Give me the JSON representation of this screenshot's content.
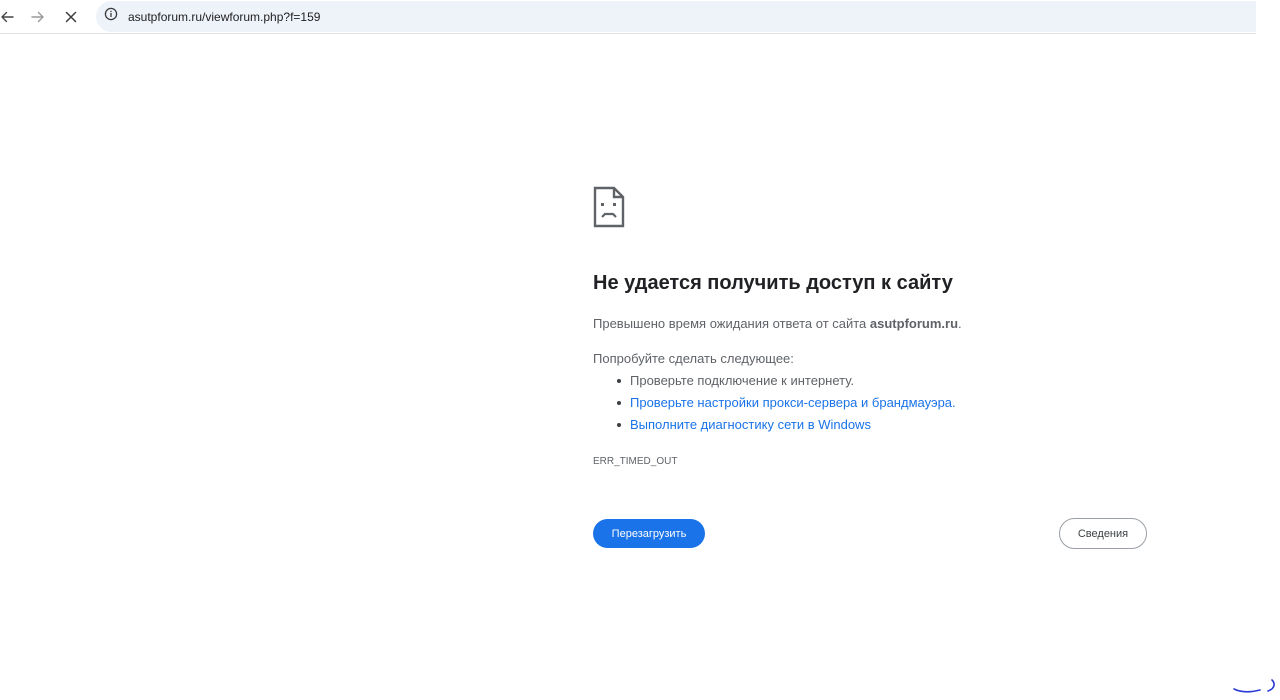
{
  "browser": {
    "url": "asutpforum.ru/viewforum.php?f=159",
    "icons": {
      "back": "arrow-left-icon",
      "forward": "arrow-right-icon",
      "stop": "close-icon",
      "site_info": "info-icon"
    }
  },
  "error_page": {
    "icon": "sad-page-icon",
    "heading": "Не удается получить доступ к сайту",
    "summary_prefix": "Превышено время ожидания ответа от сайта ",
    "summary_site": "asutpforum.ru",
    "summary_suffix": ".",
    "suggestions_title": "Попробуйте сделать следующее:",
    "suggestions": [
      {
        "text": "Проверьте подключение к интернету.",
        "link": false
      },
      {
        "text": "Проверьте настройки прокси-сервера и брандмауэра.",
        "link": true
      },
      {
        "text": "Выполните диагностику сети в Windows",
        "link": true
      }
    ],
    "error_code": "ERR_TIMED_OUT",
    "reload_label": "Перезагрузить",
    "details_label": "Сведения"
  },
  "colors": {
    "accent": "#1a73e8",
    "text_primary": "#202124",
    "text_secondary": "#5f6368",
    "omnibox_bg": "#eef2f9"
  }
}
